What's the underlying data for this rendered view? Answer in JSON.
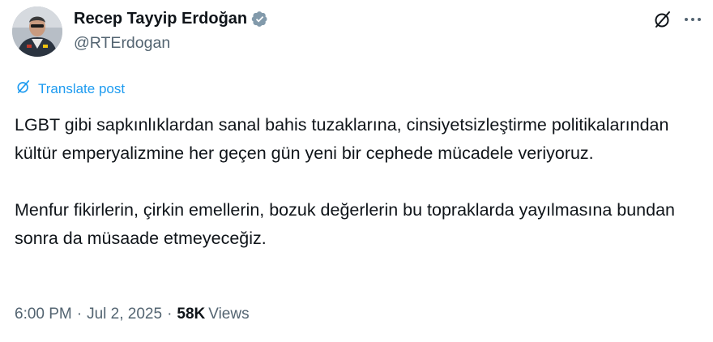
{
  "post": {
    "author": {
      "display_name": "Recep Tayyip Erdoğan",
      "handle": "@RTErdogan",
      "verified": true,
      "verified_color": "#829aab"
    },
    "translate_label": "Translate post",
    "paragraphs": [
      "LGBT gibi sapkınlıklardan sanal bahis tuzaklarına, cinsiyetsizleştirme politikalarından kültür emperyalizmine her geçen gün yeni bir cephede mücadele veriyoruz.",
      "Menfur fikirlerin, çirkin emellerin, bozuk değerlerin bu topraklarda yayılmasına bundan sonra da müsaade etmeyeceğiz."
    ],
    "meta": {
      "time": "6:00 PM",
      "separator": "·",
      "date": "Jul 2, 2025",
      "views_count": "58K",
      "views_label": "Views"
    }
  },
  "icons": {
    "avatar": "profile-photo",
    "verified": "verified-badge-icon",
    "grok": "grok-icon",
    "more": "more-options-icon",
    "translate": "translate-icon"
  },
  "colors": {
    "text_primary": "#0f1419",
    "text_secondary": "#536471",
    "link": "#1d9bf0",
    "background": "#ffffff"
  }
}
